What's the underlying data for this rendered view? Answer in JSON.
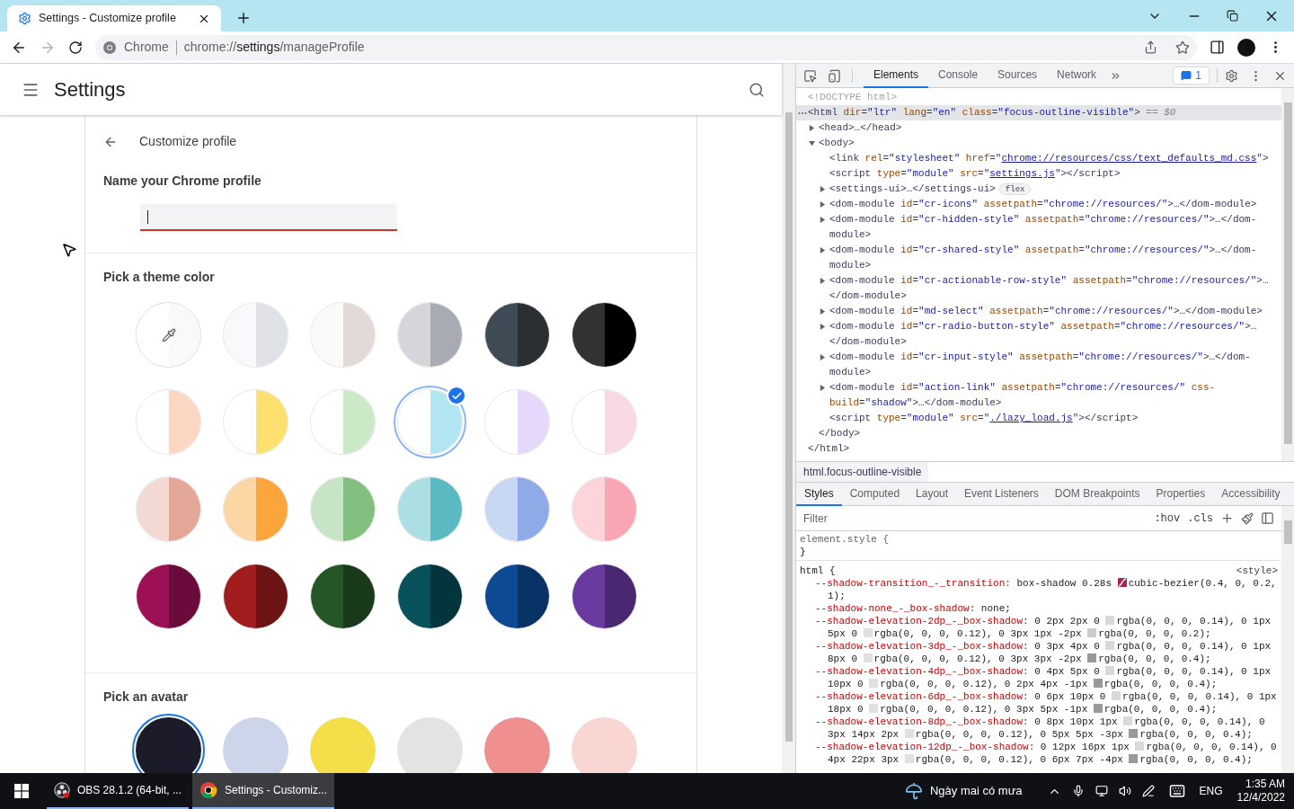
{
  "browser": {
    "tab": {
      "title": "Settings - Customize profile"
    },
    "back": {
      "disabled": false
    },
    "forward": {
      "disabled": true
    },
    "omnibox": {
      "chip": "Chrome",
      "url": "chrome://**settings**/manageProfile"
    }
  },
  "settings": {
    "title": "Settings",
    "section_title": "Customize profile",
    "name_label": "Name your Chrome profile",
    "name_field": {
      "focused": true
    },
    "theme_label": "Pick a theme color",
    "themes": [
      {
        "kind": "custom",
        "selected": false,
        "halves": [
          {
            "color": "#ffffff"
          },
          {
            "color": "#f8f9fa"
          }
        ]
      },
      {
        "kind": "color",
        "selected": false,
        "halves": [
          {
            "color": "#f8f9fa"
          },
          {
            "color": "#dee1e6"
          }
        ]
      },
      {
        "kind": "color",
        "selected": false,
        "halves": [
          {
            "color": "#fbfaf9"
          },
          {
            "color": "#e3d9d6"
          }
        ]
      },
      {
        "kind": "color",
        "selected": false,
        "halves": [
          {
            "color": "#d5d6da"
          },
          {
            "color": "#a8abb3"
          }
        ]
      },
      {
        "kind": "color",
        "selected": false,
        "halves": [
          {
            "color": "#3f4c56"
          },
          {
            "color": "#2a2f33"
          }
        ]
      },
      {
        "kind": "color",
        "selected": false,
        "halves": [
          {
            "color": "#323232"
          },
          {
            "color": "#000000"
          }
        ]
      },
      {
        "kind": "color",
        "selected": false,
        "halves": [
          {
            "color": "#ffffff"
          },
          {
            "color": "#fcd8c4"
          }
        ]
      },
      {
        "kind": "color",
        "selected": false,
        "halves": [
          {
            "color": "#ffffff"
          },
          {
            "color": "#fde06f"
          }
        ]
      },
      {
        "kind": "color",
        "selected": false,
        "halves": [
          {
            "color": "#ffffff"
          },
          {
            "color": "#cbe8c7"
          }
        ]
      },
      {
        "kind": "color",
        "selected": true,
        "halves": [
          {
            "color": "#ffffff"
          },
          {
            "color": "#b3e6f3"
          }
        ]
      },
      {
        "kind": "color",
        "selected": false,
        "halves": [
          {
            "color": "#ffffff"
          },
          {
            "color": "#e6d8fb"
          }
        ]
      },
      {
        "kind": "color",
        "selected": false,
        "halves": [
          {
            "color": "#ffffff"
          },
          {
            "color": "#f8d8e4"
          }
        ]
      },
      {
        "kind": "color",
        "selected": false,
        "halves": [
          {
            "color": "#f3d9d3"
          },
          {
            "color": "#e2a797"
          }
        ]
      },
      {
        "kind": "color",
        "selected": false,
        "halves": [
          {
            "color": "#fdd6a6"
          },
          {
            "color": "#fba53d"
          }
        ]
      },
      {
        "kind": "color",
        "selected": false,
        "halves": [
          {
            "color": "#c7e5c6"
          },
          {
            "color": "#83bf7e"
          }
        ]
      },
      {
        "kind": "color",
        "selected": false,
        "halves": [
          {
            "color": "#acdfe3"
          },
          {
            "color": "#5bb9c1"
          }
        ]
      },
      {
        "kind": "color",
        "selected": false,
        "halves": [
          {
            "color": "#c7d8f5"
          },
          {
            "color": "#8eabe8"
          }
        ]
      },
      {
        "kind": "color",
        "selected": false,
        "halves": [
          {
            "color": "#fcd4da"
          },
          {
            "color": "#f9a6b4"
          }
        ]
      },
      {
        "kind": "color",
        "selected": false,
        "halves": [
          {
            "color": "#9c1155"
          },
          {
            "color": "#6b0b3b"
          }
        ]
      },
      {
        "kind": "color",
        "selected": false,
        "halves": [
          {
            "color": "#a11d1d"
          },
          {
            "color": "#6c1313"
          }
        ]
      },
      {
        "kind": "color",
        "selected": false,
        "halves": [
          {
            "color": "#255628"
          },
          {
            "color": "#183a1b"
          }
        ]
      },
      {
        "kind": "color",
        "selected": false,
        "halves": [
          {
            "color": "#08525c"
          },
          {
            "color": "#02363c"
          }
        ]
      },
      {
        "kind": "color",
        "selected": false,
        "halves": [
          {
            "color": "#0d4a93"
          },
          {
            "color": "#093266"
          }
        ]
      },
      {
        "kind": "color",
        "selected": false,
        "halves": [
          {
            "color": "#6b3aa0"
          },
          {
            "color": "#4a2871"
          }
        ]
      }
    ],
    "avatar_label": "Pick an avatar",
    "avatars": [
      {
        "color": "#1b1b2a",
        "selected": true
      },
      {
        "color": "#cdd5ea",
        "selected": false
      },
      {
        "color": "#f4df4a",
        "selected": false
      },
      {
        "color": "#e2e4e2",
        "selected": false
      },
      {
        "color": "#f08f8f",
        "selected": false
      },
      {
        "color": "#f9d6d2",
        "selected": false
      }
    ]
  },
  "devtools": {
    "tabs": [
      {
        "label": "Elements",
        "selected": true
      },
      {
        "label": "Console",
        "selected": false
      },
      {
        "label": "Sources",
        "selected": false
      },
      {
        "label": "Network",
        "selected": false
      }
    ],
    "issues_count": "1",
    "dom": [
      {
        "tokens": [
          {
            "kind": "dim",
            "text": "<!DOCTYPE html>"
          }
        ]
      },
      {
        "selected": true,
        "suffix": " == $0",
        "tokens": [
          {
            "kind": "tag",
            "text": "<html"
          },
          {
            "kind": "attr",
            "text": " dir"
          },
          {
            "kind": "tag",
            "text": "="
          },
          {
            "kind": "val",
            "text": "\"ltr\""
          },
          {
            "kind": "attr",
            "text": " lang"
          },
          {
            "kind": "tag",
            "text": "="
          },
          {
            "kind": "val",
            "text": "\"en\""
          },
          {
            "kind": "attr",
            "text": " class"
          },
          {
            "kind": "tag",
            "text": "="
          },
          {
            "kind": "val",
            "text": "\"focus-outline-visible\""
          },
          {
            "kind": "tag",
            "text": ">"
          }
        ],
        "close": [
          {
            "kind": "tag",
            "text": "</html>"
          }
        ],
        "children": [
          {
            "expanded": false,
            "tokens": [
              {
                "kind": "tag",
                "text": "<head>…</head>"
              }
            ]
          },
          {
            "expanded": true,
            "tokens": [
              {
                "kind": "tag",
                "text": "<body>"
              }
            ],
            "close": [
              {
                "kind": "tag",
                "text": "</body>"
              }
            ],
            "children": [
              {
                "tokens": [
                  {
                    "kind": "tag",
                    "text": "<link"
                  },
                  {
                    "kind": "attr",
                    "text": " rel"
                  },
                  {
                    "kind": "tag",
                    "text": "="
                  },
                  {
                    "kind": "val",
                    "text": "\"stylesheet\""
                  },
                  {
                    "kind": "attr",
                    "text": " href"
                  },
                  {
                    "kind": "tag",
                    "text": "=\""
                  },
                  {
                    "kind": "link",
                    "text": "chrome://resources/css/text_defaults_md.css"
                  },
                  {
                    "kind": "tag",
                    "text": "\">"
                  }
                ]
              },
              {
                "tokens": [
                  {
                    "kind": "tag",
                    "text": "<script"
                  },
                  {
                    "kind": "attr",
                    "text": " type"
                  },
                  {
                    "kind": "tag",
                    "text": "="
                  },
                  {
                    "kind": "val",
                    "text": "\"module\""
                  },
                  {
                    "kind": "attr",
                    "text": " src"
                  },
                  {
                    "kind": "tag",
                    "text": "=\""
                  },
                  {
                    "kind": "link",
                    "text": "settings.js"
                  },
                  {
                    "kind": "tag",
                    "text": "\"></script>"
                  }
                ]
              },
              {
                "expanded": false,
                "badge": "flex",
                "tokens": [
                  {
                    "kind": "tag",
                    "text": "<settings-ui>…</settings-ui>"
                  }
                ]
              },
              {
                "expanded": false,
                "tokens": [
                  {
                    "kind": "tag",
                    "text": "<dom-module"
                  },
                  {
                    "kind": "attr",
                    "text": " id"
                  },
                  {
                    "kind": "tag",
                    "text": "="
                  },
                  {
                    "kind": "val",
                    "text": "\"cr-icons\""
                  },
                  {
                    "kind": "attr",
                    "text": " assetpath"
                  },
                  {
                    "kind": "tag",
                    "text": "="
                  },
                  {
                    "kind": "val",
                    "text": "\"chrome://resources/\""
                  },
                  {
                    "kind": "tag",
                    "text": ">…</dom-module>"
                  }
                ]
              },
              {
                "expanded": false,
                "tokens": [
                  {
                    "kind": "tag",
                    "text": "<dom-module"
                  },
                  {
                    "kind": "attr",
                    "text": " id"
                  },
                  {
                    "kind": "tag",
                    "text": "="
                  },
                  {
                    "kind": "val",
                    "text": "\"cr-hidden-style\""
                  },
                  {
                    "kind": "attr",
                    "text": " assetpath"
                  },
                  {
                    "kind": "tag",
                    "text": "="
                  },
                  {
                    "kind": "val",
                    "text": "\"chrome://resources/\""
                  },
                  {
                    "kind": "tag",
                    "text": ">…</dom-module>"
                  }
                ]
              },
              {
                "expanded": false,
                "tokens": [
                  {
                    "kind": "tag",
                    "text": "<dom-module"
                  },
                  {
                    "kind": "attr",
                    "text": " id"
                  },
                  {
                    "kind": "tag",
                    "text": "="
                  },
                  {
                    "kind": "val",
                    "text": "\"cr-shared-style\""
                  },
                  {
                    "kind": "attr",
                    "text": " assetpath"
                  },
                  {
                    "kind": "tag",
                    "text": "="
                  },
                  {
                    "kind": "val",
                    "text": "\"chrome://resources/\""
                  },
                  {
                    "kind": "tag",
                    "text": ">…</dom-module>"
                  }
                ]
              },
              {
                "expanded": false,
                "tokens": [
                  {
                    "kind": "tag",
                    "text": "<dom-module"
                  },
                  {
                    "kind": "attr",
                    "text": " id"
                  },
                  {
                    "kind": "tag",
                    "text": "="
                  },
                  {
                    "kind": "val",
                    "text": "\"cr-actionable-row-style\""
                  },
                  {
                    "kind": "attr",
                    "text": " assetpath"
                  },
                  {
                    "kind": "tag",
                    "text": "="
                  },
                  {
                    "kind": "val",
                    "text": "\"chrome://resources/\""
                  },
                  {
                    "kind": "tag",
                    "text": ">… </dom-module>"
                  }
                ]
              },
              {
                "expanded": false,
                "tokens": [
                  {
                    "kind": "tag",
                    "text": "<dom-module"
                  },
                  {
                    "kind": "attr",
                    "text": " id"
                  },
                  {
                    "kind": "tag",
                    "text": "="
                  },
                  {
                    "kind": "val",
                    "text": "\"md-select\""
                  },
                  {
                    "kind": "attr",
                    "text": " assetpath"
                  },
                  {
                    "kind": "tag",
                    "text": "="
                  },
                  {
                    "kind": "val",
                    "text": "\"chrome://resources/\""
                  },
                  {
                    "kind": "tag",
                    "text": ">…</dom-module>"
                  }
                ]
              },
              {
                "expanded": false,
                "tokens": [
                  {
                    "kind": "tag",
                    "text": "<dom-module"
                  },
                  {
                    "kind": "attr",
                    "text": " id"
                  },
                  {
                    "kind": "tag",
                    "text": "="
                  },
                  {
                    "kind": "val",
                    "text": "\"cr-radio-button-style\""
                  },
                  {
                    "kind": "attr",
                    "text": " assetpath"
                  },
                  {
                    "kind": "tag",
                    "text": "="
                  },
                  {
                    "kind": "val",
                    "text": "\"chrome://resources/\""
                  },
                  {
                    "kind": "tag",
                    "text": ">… </dom-module>"
                  }
                ]
              },
              {
                "expanded": false,
                "tokens": [
                  {
                    "kind": "tag",
                    "text": "<dom-module"
                  },
                  {
                    "kind": "attr",
                    "text": " id"
                  },
                  {
                    "kind": "tag",
                    "text": "="
                  },
                  {
                    "kind": "val",
                    "text": "\"cr-input-style\""
                  },
                  {
                    "kind": "attr",
                    "text": " assetpath"
                  },
                  {
                    "kind": "tag",
                    "text": "="
                  },
                  {
                    "kind": "val",
                    "text": "\"chrome://resources/\""
                  },
                  {
                    "kind": "tag",
                    "text": ">…</dom-module>"
                  }
                ]
              },
              {
                "expanded": false,
                "tokens": [
                  {
                    "kind": "tag",
                    "text": "<dom-module"
                  },
                  {
                    "kind": "attr",
                    "text": " id"
                  },
                  {
                    "kind": "tag",
                    "text": "="
                  },
                  {
                    "kind": "val",
                    "text": "\"action-link\""
                  },
                  {
                    "kind": "attr",
                    "text": " assetpath"
                  },
                  {
                    "kind": "tag",
                    "text": "="
                  },
                  {
                    "kind": "val",
                    "text": "\"chrome://resources/\""
                  },
                  {
                    "kind": "attr",
                    "text": " css-build"
                  },
                  {
                    "kind": "tag",
                    "text": "="
                  },
                  {
                    "kind": "val",
                    "text": "\"shadow\""
                  },
                  {
                    "kind": "tag",
                    "text": ">…</dom-module>"
                  }
                ]
              },
              {
                "tokens": [
                  {
                    "kind": "tag",
                    "text": "<script"
                  },
                  {
                    "kind": "attr",
                    "text": " type"
                  },
                  {
                    "kind": "tag",
                    "text": "="
                  },
                  {
                    "kind": "val",
                    "text": "\"module\""
                  },
                  {
                    "kind": "attr",
                    "text": " src"
                  },
                  {
                    "kind": "tag",
                    "text": "=\""
                  },
                  {
                    "kind": "link",
                    "text": "./lazy_load.js"
                  },
                  {
                    "kind": "tag",
                    "text": "\"></script>"
                  }
                ]
              }
            ]
          }
        ]
      }
    ],
    "breadcrumb": "html.focus-outline-visible",
    "style_tabs": [
      {
        "label": "Styles",
        "selected": true
      },
      {
        "label": "Computed",
        "selected": false
      },
      {
        "label": "Layout",
        "selected": false
      },
      {
        "label": "Event Listeners",
        "selected": false
      },
      {
        "label": "DOM Breakpoints",
        "selected": false
      },
      {
        "label": "Properties",
        "selected": false
      },
      {
        "label": "Accessibility",
        "selected": false
      }
    ],
    "filter": {
      "placeholder": "Filter"
    },
    "hov": ":hov",
    "cls": ".cls",
    "element_style": {
      "open": "element.style {",
      "close": "}"
    },
    "rule": {
      "selector": "html {",
      "source": "<style>",
      "declarations": [
        {
          "name": "--shadow-transition_-_transition:",
          "value": [
            " box-shadow 0.28s ",
            {
              "kind": "curve"
            },
            "cubic-bezier(0.4, 0, 0.2, 1);"
          ]
        },
        {
          "name": "--shadow-none_-_box-shadow:",
          "value": [
            " none;"
          ]
        },
        {
          "name": "--shadow-elevation-2dp_-_box-shadow:",
          "value": [
            " 0 2px 2px 0 ",
            {
              "kind": "swatch",
              "color": "#d9d9d9"
            },
            "rgba(0, 0, 0, 0.14), 0 1px 5px 0 ",
            {
              "kind": "swatch",
              "color": "#e0e0e0"
            },
            "rgba(0, 0, 0, 0.12), 0 3px 1px -2px ",
            {
              "kind": "swatch",
              "color": "#cccccc"
            },
            "rgba(0, 0, 0, 0.2);"
          ]
        },
        {
          "name": "--shadow-elevation-3dp_-_box-shadow:",
          "value": [
            " 0 3px 4px 0 ",
            {
              "kind": "swatch",
              "color": "#d9d9d9"
            },
            "rgba(0, 0, 0, 0.14), 0 1px 8px 0 ",
            {
              "kind": "swatch",
              "color": "#e0e0e0"
            },
            "rgba(0, 0, 0, 0.12), 0 3px 3px -2px ",
            {
              "kind": "swatch",
              "color": "#999999"
            },
            "rgba(0, 0, 0, 0.4);"
          ]
        },
        {
          "name": "--shadow-elevation-4dp_-_box-shadow:",
          "value": [
            " 0 4px 5px 0 ",
            {
              "kind": "swatch",
              "color": "#d9d9d9"
            },
            "rgba(0, 0, 0, 0.14), 0 1px 10px 0 ",
            {
              "kind": "swatch",
              "color": "#e0e0e0"
            },
            "rgba(0, 0, 0, 0.12), 0 2px 4px -1px ",
            {
              "kind": "swatch",
              "color": "#999999"
            },
            "rgba(0, 0, 0, 0.4);"
          ]
        },
        {
          "name": "--shadow-elevation-6dp_-_box-shadow:",
          "value": [
            " 0 6px 10px 0 ",
            {
              "kind": "swatch",
              "color": "#d9d9d9"
            },
            "rgba(0, 0, 0, 0.14), 0 1px 18px 0 ",
            {
              "kind": "swatch",
              "color": "#e0e0e0"
            },
            "rgba(0, 0, 0, 0.12), 0 3px 5px -1px ",
            {
              "kind": "swatch",
              "color": "#999999"
            },
            "rgba(0, 0, 0, 0.4);"
          ]
        },
        {
          "name": "--shadow-elevation-8dp_-_box-shadow:",
          "value": [
            " 0 8px 10px 1px ",
            {
              "kind": "swatch",
              "color": "#d9d9d9"
            },
            "rgba(0, 0, 0, 0.14), 0 3px 14px 2px ",
            {
              "kind": "swatch",
              "color": "#e0e0e0"
            },
            "rgba(0, 0, 0, 0.12), 0 5px 5px -3px ",
            {
              "kind": "swatch",
              "color": "#999999"
            },
            "rgba(0, 0, 0, 0.4);"
          ]
        },
        {
          "name": "--shadow-elevation-12dp_-_box-shadow:",
          "value": [
            " 0 12px 16px 1px ",
            {
              "kind": "swatch",
              "color": "#d9d9d9"
            },
            "rgba(0, 0, 0, 0.14), 0 4px 22px 3px ",
            {
              "kind": "swatch",
              "color": "#e0e0e0"
            },
            "rgba(0, 0, 0, 0.12), 0 6px 7px -4px ",
            {
              "kind": "swatch",
              "color": "#999999"
            },
            "rgba(0, 0, 0, 0.4);"
          ]
        }
      ]
    }
  },
  "taskbar": {
    "items": [
      {
        "kind": "obs",
        "label": "OBS 28.1.2 (64-bit, ...",
        "selected": false
      },
      {
        "kind": "chrome",
        "label": "Settings - Customiz...",
        "selected": true
      }
    ],
    "weather": "Ngày mai có mưa",
    "lang": "ENG",
    "time": "1:35 AM",
    "date": "12/4/2022"
  }
}
